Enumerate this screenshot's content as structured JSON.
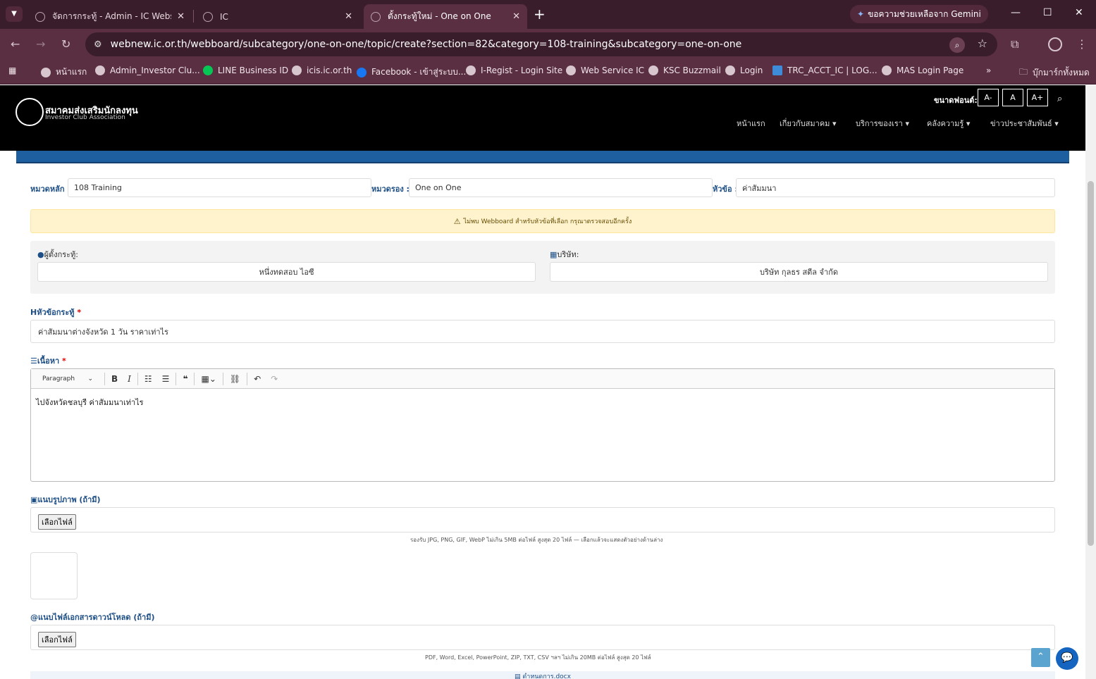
{
  "browser": {
    "tabs": [
      {
        "title": "จัดการกระทู้ - Admin - IC Website"
      },
      {
        "title": "IC"
      },
      {
        "title": "ตั้งกระทู้ใหม่ - One on One"
      }
    ],
    "gemini_label": "ขอความช่วยเหลือจาก Gemini",
    "url": "webnew.ic.or.th/webboard/subcategory/one-on-one/topic/create?section=82&category=108-training&subcategory=one-on-one",
    "bookmarks": [
      "หน้าแรก",
      "Admin_Investor Clu...",
      "LINE Business ID",
      "icis.ic.or.th",
      "Facebook - เข้าสู่ระบบ...",
      "I-Regist - Login Site",
      "Web Service IC",
      "KSC Buzzmail",
      "Login",
      "TRC_ACCT_IC | LOG...",
      "MAS Login Page"
    ],
    "all_bookmarks": "บุ๊กมาร์กทั้งหมด"
  },
  "site": {
    "logo_th": "สมาคมส่งเสริมนักลงทุน",
    "logo_en": "Investor Club Association",
    "font_size_label": "ขนาดฟอนต์:",
    "font_buttons": [
      "A-",
      "A",
      "A+"
    ],
    "menu": [
      "หน้าแรก",
      "เกี่ยวกับสมาคม",
      "บริการของเรา",
      "คลังความรู้",
      "ข่าวประชาสัมพันธ์"
    ]
  },
  "form": {
    "main_category_label": "หมวดหลัก :",
    "main_category_value": "108 Training",
    "sub_category_label": "หมวดรอง :",
    "sub_category_value": "One on One",
    "topic_label": "หัวข้อ :",
    "topic_value": "ค่าสัมมนา",
    "warning": "ไม่พบ Webboard สำหรับหัวข้อที่เลือก กรุณาตรวจสอบอีกครั้ง",
    "poster_label": "ผู้ตั้งกระทู้:",
    "poster_value": "หนึ่งทดสอบ ไอซี",
    "company_label": "บริษัท:",
    "company_value": "บริษัท กุลธร สตีล จำกัด",
    "title_label": "หัวข้อกระทู้",
    "title_value": "ค่าสัมมนาต่างจังหวัด 1 วัน ราคาเท่าไร",
    "content_label": "เนื้อหา",
    "required_mark": "*",
    "editor_paragraph": "Paragraph",
    "content_value": "ไปจังหวัดชลบุรี ค่าสัมมนาเท่าไร",
    "image_label": "แนบรูปภาพ (ถ้ามี)",
    "choose_file": "เลือกไฟล์",
    "image_hint": "รองรับ JPG, PNG, GIF, WebP ไม่เกิน 5MB ต่อไฟล์ สูงสุด 20 ไฟล์ — เลือกแล้วจะแสดงตัวอย่างด้านล่าง",
    "file_label": "แนบไฟล์เอกสารดาวน์โหลด (ถ้ามี)",
    "file_hint": "PDF, Word, Excel, PowerPoint, ZIP, TXT, CSV ฯลฯ ไม่เกิน 20MB ต่อไฟล์ สูงสุด 20 ไฟล์",
    "doc_item": "ดำหนดการ.docx"
  }
}
